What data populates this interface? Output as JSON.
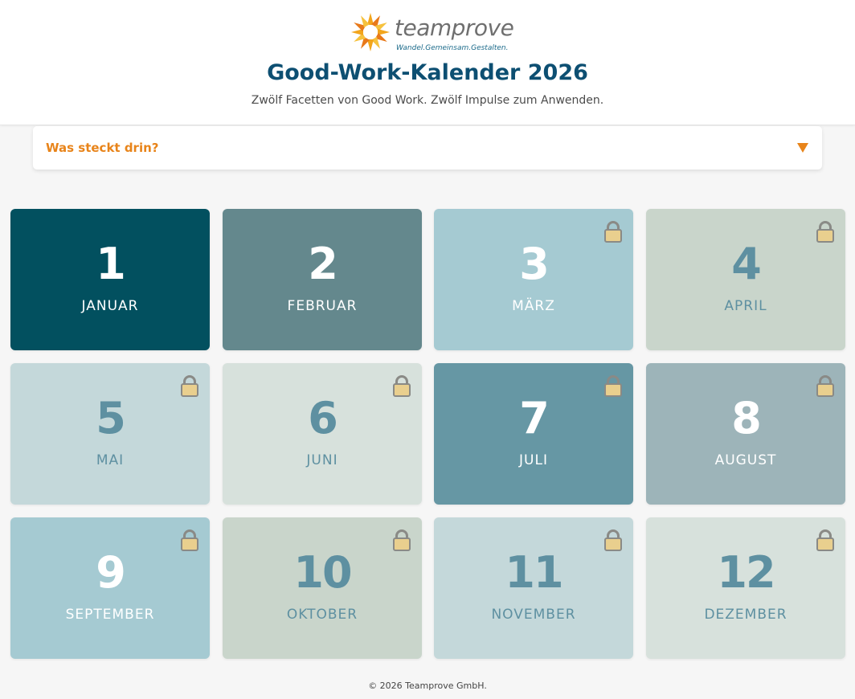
{
  "header": {
    "logo_text": "teamprove",
    "logo_tagline": "Wandel.Gemeinsam.Gestalten.",
    "title": "Good-Work-Kalender 2026",
    "subtitle": "Zwölf Facetten von Good Work. Zwölf Impulse zum Anwenden."
  },
  "accordion": {
    "label": "Was steckt drin?",
    "icon": "triangle-down-icon",
    "color": "#e8841a"
  },
  "months": [
    {
      "number": "1",
      "name": "JANUAR",
      "locked": false,
      "color": "#02505f",
      "text": "light-on-dark"
    },
    {
      "number": "2",
      "name": "FEBRUAR",
      "locked": false,
      "color": "#64888d",
      "text": "light-on-dark"
    },
    {
      "number": "3",
      "name": "MÄRZ",
      "locked": true,
      "color": "#a5cad2",
      "text": "light-on-dark"
    },
    {
      "number": "4",
      "name": "APRIL",
      "locked": true,
      "color": "#c9d5cb",
      "text": "dark-on-light"
    },
    {
      "number": "5",
      "name": "MAI",
      "locked": true,
      "color": "#c4d8da",
      "text": "dark-on-light"
    },
    {
      "number": "6",
      "name": "JUNI",
      "locked": true,
      "color": "#d7e1dc",
      "text": "dark-on-light"
    },
    {
      "number": "7",
      "name": "JULI",
      "locked": true,
      "color": "#6697a4",
      "text": "light-on-dark"
    },
    {
      "number": "8",
      "name": "AUGUST",
      "locked": true,
      "color": "#9db4b9",
      "text": "light-on-dark"
    },
    {
      "number": "9",
      "name": "SEPTEMBER",
      "locked": true,
      "color": "#a5cad2",
      "text": "light-on-dark"
    },
    {
      "number": "10",
      "name": "OKTOBER",
      "locked": true,
      "color": "#c9d5cb",
      "text": "dark-on-light"
    },
    {
      "number": "11",
      "name": "NOVEMBER",
      "locked": true,
      "color": "#c4d8da",
      "text": "dark-on-light"
    },
    {
      "number": "12",
      "name": "DEZEMBER",
      "locked": true,
      "color": "#d7e1dc",
      "text": "dark-on-light"
    }
  ],
  "lock_icon": "lock-icon",
  "footer": {
    "copyright": "© 2026 Teamprove GmbH."
  }
}
